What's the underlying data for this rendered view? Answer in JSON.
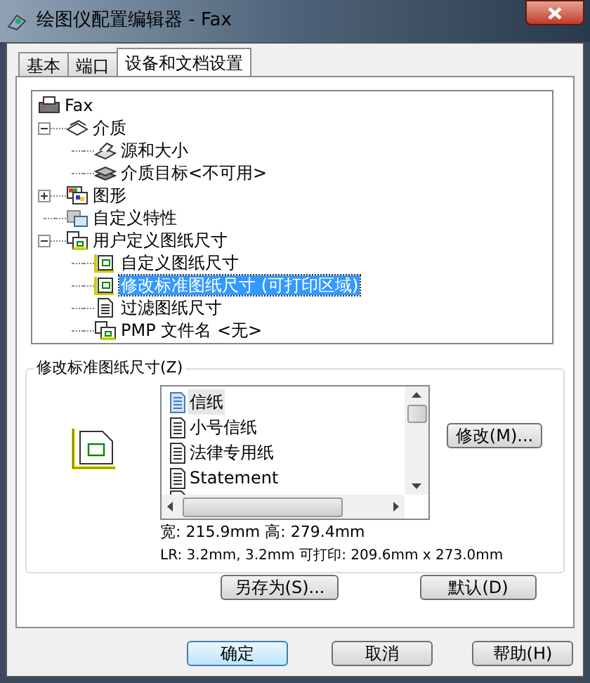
{
  "window": {
    "title": "绘图仪配置编辑器 - Fax"
  },
  "tabs": [
    {
      "label": "基本",
      "selected": false
    },
    {
      "label": "端口",
      "selected": false
    },
    {
      "label": "设备和文档设置",
      "selected": true
    }
  ],
  "tree": [
    {
      "label": "Fax",
      "kind": "printer",
      "selected": false,
      "children": [
        {
          "label": "介质",
          "kind": "media",
          "expanded": true,
          "selected": false,
          "children": [
            {
              "label": "源和大小",
              "kind": "source",
              "selected": false
            },
            {
              "label": "介质目标<不可用>",
              "kind": "stack",
              "selected": false
            }
          ]
        },
        {
          "label": "图形",
          "kind": "graphics",
          "expanded": false,
          "selected": false
        },
        {
          "label": "自定义特性",
          "kind": "custom",
          "selected": false
        },
        {
          "label": "用户定义图纸尺寸",
          "kind": "sizes",
          "expanded": true,
          "selected": false,
          "children": [
            {
              "label": "自定义图纸尺寸",
              "kind": "page",
              "selected": false
            },
            {
              "label": "修改标准图纸尺寸 (可打印区域)",
              "kind": "page",
              "selected": true
            },
            {
              "label": "过滤图纸尺寸",
              "kind": "document",
              "selected": false
            },
            {
              "label": "PMP 文件名 <无>",
              "kind": "sizes",
              "selected": false
            }
          ]
        }
      ]
    }
  ],
  "group": {
    "title": "修改标准图纸尺寸(Z)",
    "paper_sizes": [
      {
        "label": "信纸",
        "selected": true
      },
      {
        "label": "小号信纸",
        "selected": false
      },
      {
        "label": "法律专用纸",
        "selected": false
      },
      {
        "label": "Statement",
        "selected": false
      }
    ],
    "modify_button": "修改(M)...",
    "size_line": "宽: 215.9mm 高: 279.4mm",
    "margin_line": "LR: 3.2mm, 3.2mm 可打印: 209.6mm x 273.0mm",
    "save_as_button": "另存为(S)...",
    "default_button": "默认(D)"
  },
  "buttons": [
    {
      "label": "确定",
      "kind": "default"
    },
    {
      "label": "取消",
      "kind": "normal"
    },
    {
      "label": "帮助(H)",
      "kind": "normal"
    }
  ]
}
